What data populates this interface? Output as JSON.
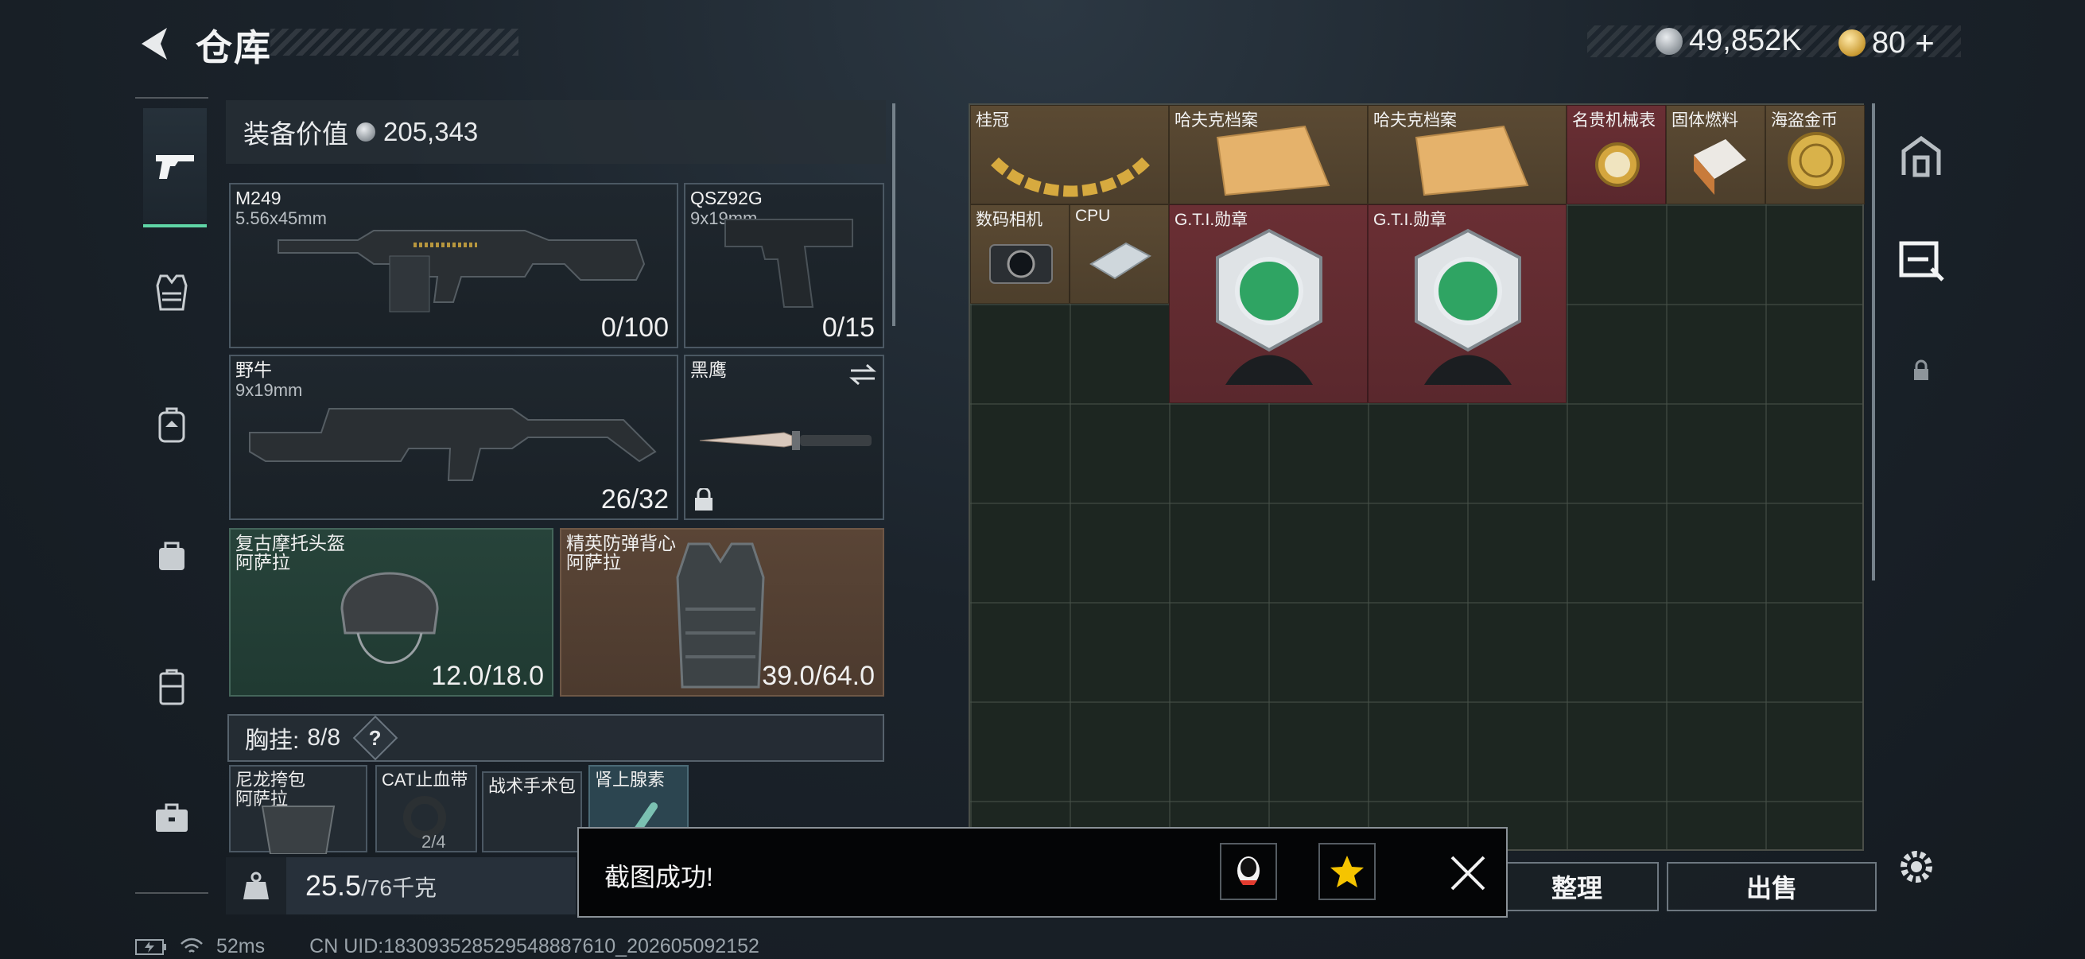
{
  "header": {
    "title": "仓库",
    "currency_silver": "49,852K",
    "currency_gold": "80",
    "plus": "+"
  },
  "left_nav": {
    "items": [
      "gun-icon",
      "vest-icon",
      "backpack-icon",
      "bag-icon",
      "case-icon",
      "briefcase-icon"
    ]
  },
  "equipment": {
    "value_label": "装备价值",
    "value": "205,343",
    "primary": {
      "name": "M249",
      "ammo": "5.56x45mm",
      "count": "0/100"
    },
    "pistol": {
      "name": "QSZ92G",
      "ammo": "9x19mm",
      "count": "0/15"
    },
    "secondary": {
      "name": "野牛",
      "ammo": "9x19mm",
      "count": "26/32"
    },
    "melee": {
      "name": "黑鹰"
    },
    "helmet": {
      "name": "复古摩托头盔",
      "brand": "阿萨拉",
      "durability": "12.0/18.0"
    },
    "armor": {
      "name": "精英防弹背心",
      "brand": "阿萨拉",
      "durability": "39.0/64.0"
    }
  },
  "chest_rig": {
    "label": "胸挂:",
    "capacity": "8/8",
    "help": "?",
    "slots": [
      {
        "name": "尼龙挎包",
        "brand": "阿萨拉"
      },
      {
        "name": "CAT止血带",
        "count": "2/4"
      },
      {
        "name": "战术手术包"
      },
      {
        "name": "肾上腺素"
      }
    ]
  },
  "weight": {
    "current": "25.5",
    "max": "/76千克"
  },
  "stash_items": [
    {
      "name": "桂冠"
    },
    {
      "name": "哈夫克档案"
    },
    {
      "name": "哈夫克档案"
    },
    {
      "name": "名贵机械表"
    },
    {
      "name": "固体燃料"
    },
    {
      "name": "海盗金币"
    },
    {
      "name": "数码相机"
    },
    {
      "name": "CPU"
    },
    {
      "name": "G.T.I.勋章"
    },
    {
      "name": "G.T.I.勋章"
    }
  ],
  "actions": {
    "sort": "整理",
    "sell": "出售"
  },
  "toast": {
    "message": "截图成功!"
  },
  "status": {
    "ping": "52ms",
    "uid": "CN UID:183093528529548887610_202605092152"
  },
  "colors": {
    "accent_green": "#5fd5a6",
    "slot_gold": "#5b4a33",
    "slot_red": "#6a2f34"
  }
}
